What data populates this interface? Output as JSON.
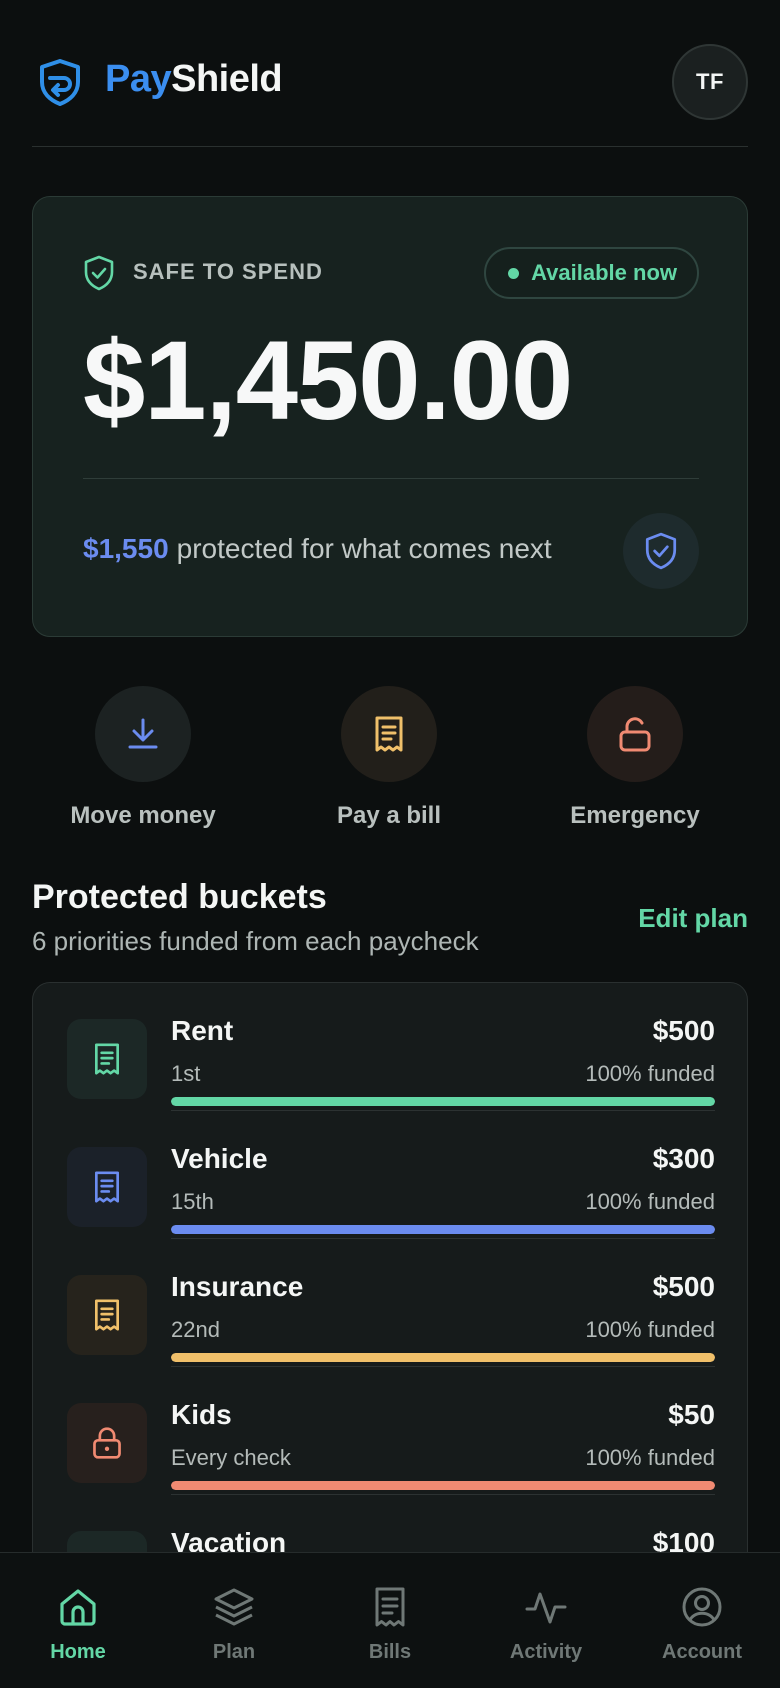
{
  "header": {
    "brand_pay": "Pay",
    "brand_shield": "Shield",
    "avatar_initials": "TF"
  },
  "hero": {
    "label": "SAFE TO SPEND",
    "status": "Available now",
    "amount": "$1,450.00",
    "protected_amount": "$1,550",
    "protected_text": "protected for what comes next"
  },
  "actions": [
    {
      "label": "Move money",
      "icon": "download-icon",
      "color": "#6b8cf0"
    },
    {
      "label": "Pay a bill",
      "icon": "receipt-icon",
      "color": "#f0c06a"
    },
    {
      "label": "Emergency",
      "icon": "unlock-icon",
      "color": "#f08a72"
    }
  ],
  "section": {
    "title": "Protected buckets",
    "subtitle": "6 priorities funded from each paycheck",
    "edit_label": "Edit plan"
  },
  "buckets": [
    {
      "name": "Rent",
      "amount": "$500",
      "due": "1st",
      "funded": "100% funded",
      "progress": 1.0,
      "color": "#63d7a6",
      "icon": "receipt-icon",
      "icon_bg": "#1c2826"
    },
    {
      "name": "Vehicle",
      "amount": "$300",
      "due": "15th",
      "funded": "100% funded",
      "progress": 1.0,
      "color": "#6b8cf0",
      "icon": "receipt-icon",
      "icon_bg": "#1b2129"
    },
    {
      "name": "Insurance",
      "amount": "$500",
      "due": "22nd",
      "funded": "100% funded",
      "progress": 1.0,
      "color": "#f0c06a",
      "icon": "receipt-icon",
      "icon_bg": "#26231c"
    },
    {
      "name": "Kids",
      "amount": "$50",
      "due": "Every check",
      "funded": "100% funded",
      "progress": 1.0,
      "color": "#f08a72",
      "icon": "lock-icon",
      "icon_bg": "#27201d"
    },
    {
      "name": "Vacation",
      "amount": "$100",
      "due": "",
      "funded": "",
      "progress": 1.0,
      "color": "#63d7a6",
      "icon": "receipt-icon",
      "icon_bg": "#1c2826"
    }
  ],
  "nav": [
    {
      "label": "Home",
      "icon": "home-icon",
      "active": true
    },
    {
      "label": "Plan",
      "icon": "layers-icon",
      "active": false
    },
    {
      "label": "Bills",
      "icon": "receipt-icon",
      "active": false
    },
    {
      "label": "Activity",
      "icon": "activity-icon",
      "active": false
    },
    {
      "label": "Account",
      "icon": "account-icon",
      "active": false
    }
  ],
  "colors": {
    "accent_green": "#63d7a6",
    "accent_blue": "#6b8cf0",
    "brand_blue": "#3b8ef0",
    "background": "#0c0f0f"
  }
}
